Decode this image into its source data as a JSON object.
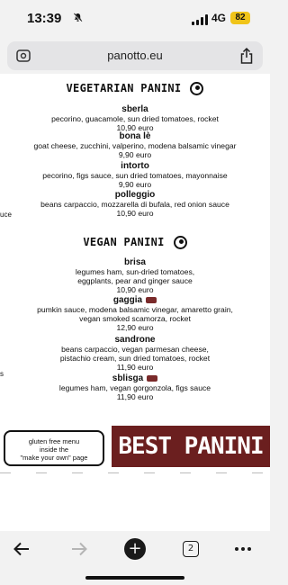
{
  "status": {
    "time": "13:39",
    "network": "4G",
    "battery": "82"
  },
  "browser": {
    "url": "panotto.eu"
  },
  "menu": {
    "vegetarian_title": "VEGETARIAN PANINI",
    "vegetarian": [
      {
        "name": "sberla",
        "ingredients": [
          "pecorino, guacamole, sun dried tomatoes, rocket"
        ],
        "price": "10,90 euro"
      },
      {
        "name": "bona lè",
        "ingredients": [
          "goat cheese, zucchini, valperino, modena balsamic vinegar"
        ],
        "price": "9,90 euro"
      },
      {
        "name": "intorto",
        "ingredients": [
          "pecorino, figs sauce, sun dried tomatoes, mayonnaise"
        ],
        "price": "9,90 euro"
      },
      {
        "name": "polleggio",
        "ingredients": [
          "beans carpaccio, mozzarella di bufala, red onion sauce"
        ],
        "price": "10,90 euro"
      }
    ],
    "vegan_title": "VEGAN PANINI",
    "vegan": [
      {
        "name": "brisa",
        "ingredients": [
          "legumes ham, sun-dried tomatoes,",
          "eggplants, pear and ginger sauce"
        ],
        "price": "10,90 euro"
      },
      {
        "name": "gaggia",
        "ingredients": [
          "pumkin sauce, modena balsamic vinegar, amaretto grain,",
          "vegan smoked scamorza, rocket"
        ],
        "price": "12,90 euro"
      },
      {
        "name": "sandrone",
        "ingredients": [
          "beans carpaccio, vegan parmesan cheese,",
          "pistachio cream, sun dried tomatoes, rocket"
        ],
        "price": "11,90 euro"
      },
      {
        "name": "sblisga",
        "ingredients": [
          "legumes ham, vegan gorgonzola, figs sauce"
        ],
        "price": "11,90 euro"
      }
    ],
    "edge_fragment": "uce",
    "edge_fragment2": "s"
  },
  "promo": {
    "gluten_free_line1": "gluten free menu",
    "gluten_free_line2": "inside the",
    "gluten_free_line3": "\"make your own\" page",
    "banner": "BEST PANINI"
  },
  "toolbar": {
    "tabs_count": "2"
  },
  "icons": [
    "bell-slash-icon",
    "signal-icon",
    "tab-tools-icon",
    "share-icon",
    "back-icon",
    "forward-icon",
    "new-tab-icon",
    "tabs-icon",
    "more-icon",
    "leaf-icon",
    "gluten-free-badge"
  ]
}
